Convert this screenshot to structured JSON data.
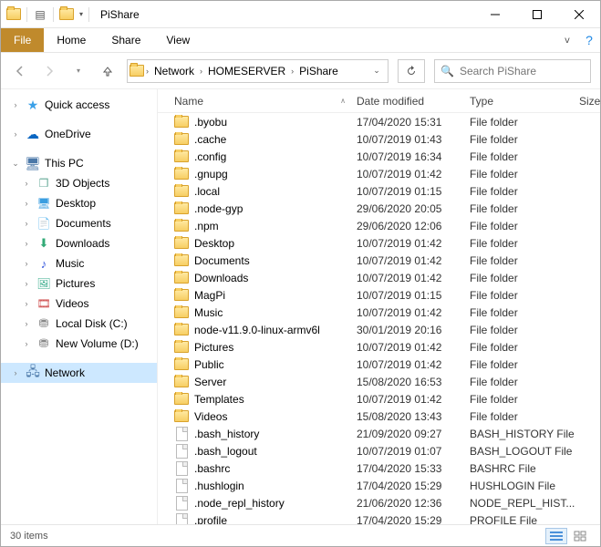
{
  "window": {
    "title": "PiShare"
  },
  "ribbon": {
    "file": "File",
    "home": "Home",
    "share": "Share",
    "view": "View"
  },
  "address": {
    "root": "Network",
    "host": "HOMESERVER",
    "folder": "PiShare"
  },
  "search": {
    "placeholder": "Search PiShare"
  },
  "nav": {
    "quick_access": "Quick access",
    "onedrive": "OneDrive",
    "this_pc": "This PC",
    "objects3d": "3D Objects",
    "desktop": "Desktop",
    "documents": "Documents",
    "downloads": "Downloads",
    "music": "Music",
    "pictures": "Pictures",
    "videos": "Videos",
    "local_disk": "Local Disk (C:)",
    "new_volume": "New Volume (D:)",
    "network": "Network"
  },
  "columns": {
    "name": "Name",
    "date": "Date modified",
    "type": "Type",
    "size": "Size"
  },
  "folder_type": "File folder",
  "items": [
    {
      "name": ".byobu",
      "date": "17/04/2020 15:31",
      "type": "File folder",
      "kind": "folder"
    },
    {
      "name": ".cache",
      "date": "10/07/2019 01:43",
      "type": "File folder",
      "kind": "folder"
    },
    {
      "name": ".config",
      "date": "10/07/2019 16:34",
      "type": "File folder",
      "kind": "folder"
    },
    {
      "name": ".gnupg",
      "date": "10/07/2019 01:42",
      "type": "File folder",
      "kind": "folder"
    },
    {
      "name": ".local",
      "date": "10/07/2019 01:15",
      "type": "File folder",
      "kind": "folder"
    },
    {
      "name": ".node-gyp",
      "date": "29/06/2020 20:05",
      "type": "File folder",
      "kind": "folder"
    },
    {
      "name": ".npm",
      "date": "29/06/2020 12:06",
      "type": "File folder",
      "kind": "folder"
    },
    {
      "name": "Desktop",
      "date": "10/07/2019 01:42",
      "type": "File folder",
      "kind": "folder"
    },
    {
      "name": "Documents",
      "date": "10/07/2019 01:42",
      "type": "File folder",
      "kind": "folder"
    },
    {
      "name": "Downloads",
      "date": "10/07/2019 01:42",
      "type": "File folder",
      "kind": "folder"
    },
    {
      "name": "MagPi",
      "date": "10/07/2019 01:15",
      "type": "File folder",
      "kind": "folder"
    },
    {
      "name": "Music",
      "date": "10/07/2019 01:42",
      "type": "File folder",
      "kind": "folder"
    },
    {
      "name": "node-v11.9.0-linux-armv6l",
      "date": "30/01/2019 20:16",
      "type": "File folder",
      "kind": "folder"
    },
    {
      "name": "Pictures",
      "date": "10/07/2019 01:42",
      "type": "File folder",
      "kind": "folder"
    },
    {
      "name": "Public",
      "date": "10/07/2019 01:42",
      "type": "File folder",
      "kind": "folder"
    },
    {
      "name": "Server",
      "date": "15/08/2020 16:53",
      "type": "File folder",
      "kind": "folder"
    },
    {
      "name": "Templates",
      "date": "10/07/2019 01:42",
      "type": "File folder",
      "kind": "folder"
    },
    {
      "name": "Videos",
      "date": "15/08/2020 13:43",
      "type": "File folder",
      "kind": "folder"
    },
    {
      "name": ".bash_history",
      "date": "21/09/2020 09:27",
      "type": "BASH_HISTORY File",
      "kind": "file"
    },
    {
      "name": ".bash_logout",
      "date": "10/07/2019 01:07",
      "type": "BASH_LOGOUT File",
      "kind": "file"
    },
    {
      "name": ".bashrc",
      "date": "17/04/2020 15:33",
      "type": "BASHRC File",
      "kind": "file"
    },
    {
      "name": ".hushlogin",
      "date": "17/04/2020 15:29",
      "type": "HUSHLOGIN File",
      "kind": "file"
    },
    {
      "name": ".node_repl_history",
      "date": "21/06/2020 12:36",
      "type": "NODE_REPL_HIST...",
      "kind": "file"
    },
    {
      "name": ".profile",
      "date": "17/04/2020 15:29",
      "type": "PROFILE File",
      "kind": "file"
    }
  ],
  "status": {
    "count": "30 items"
  }
}
